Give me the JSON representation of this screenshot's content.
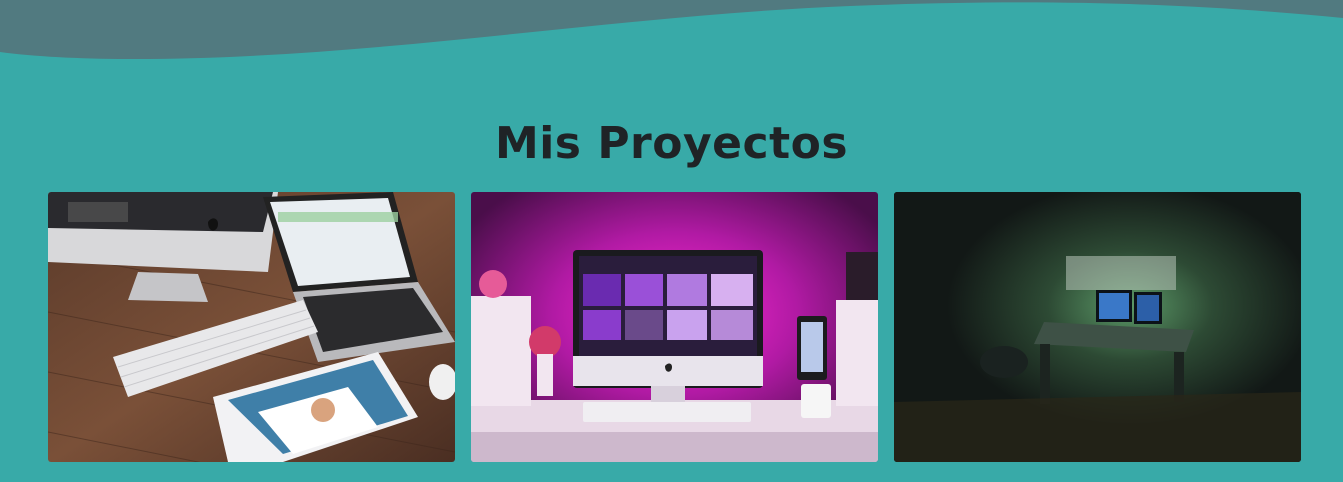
{
  "colors": {
    "background": "#38aaa8",
    "wave": "#517a80",
    "title": "#1f2326"
  },
  "section": {
    "title": "Mis Proyectos"
  },
  "projects": [
    {
      "image": "desk-with-imac-macbook-ipad-photo"
    },
    {
      "image": "pink-lit-imac-desk-setup-photo"
    },
    {
      "image": "dark-room-green-lit-workstation-photo"
    }
  ]
}
